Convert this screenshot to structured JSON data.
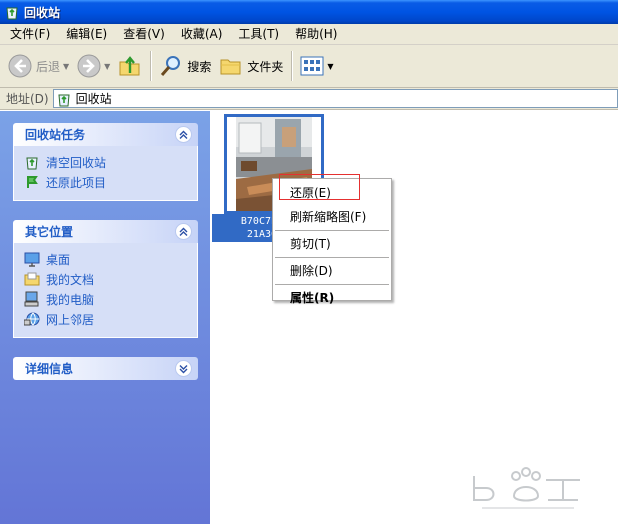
{
  "window": {
    "title": "回收站"
  },
  "menu": [
    "文件(F)",
    "编辑(E)",
    "查看(V)",
    "收藏(A)",
    "工具(T)",
    "帮助(H)"
  ],
  "toolbar": {
    "back_label": "后退",
    "search_label": "搜索",
    "folders_label": "文件夹"
  },
  "address": {
    "label": "地址(D)",
    "value": "回收站"
  },
  "tasks": {
    "title": "回收站任务",
    "items": [
      "清空回收站",
      "还原此项目"
    ]
  },
  "places": {
    "title": "其它位置",
    "items": [
      "桌面",
      "我的文档",
      "我的电脑",
      "网上邻居"
    ]
  },
  "details": {
    "title": "详细信息"
  },
  "file": {
    "name_line1": "B70C7EAA01",
    "name_line2": "21A3CF89"
  },
  "context_menu": {
    "items": [
      "还原(E)",
      "刷新缩略图(F)",
      "剪切(T)",
      "删除(D)",
      "属性(R)"
    ]
  },
  "colors": {
    "titlebar": "#0054e3",
    "selection": "#316ac5",
    "link": "#215dc6",
    "highlight": "#e53030"
  }
}
